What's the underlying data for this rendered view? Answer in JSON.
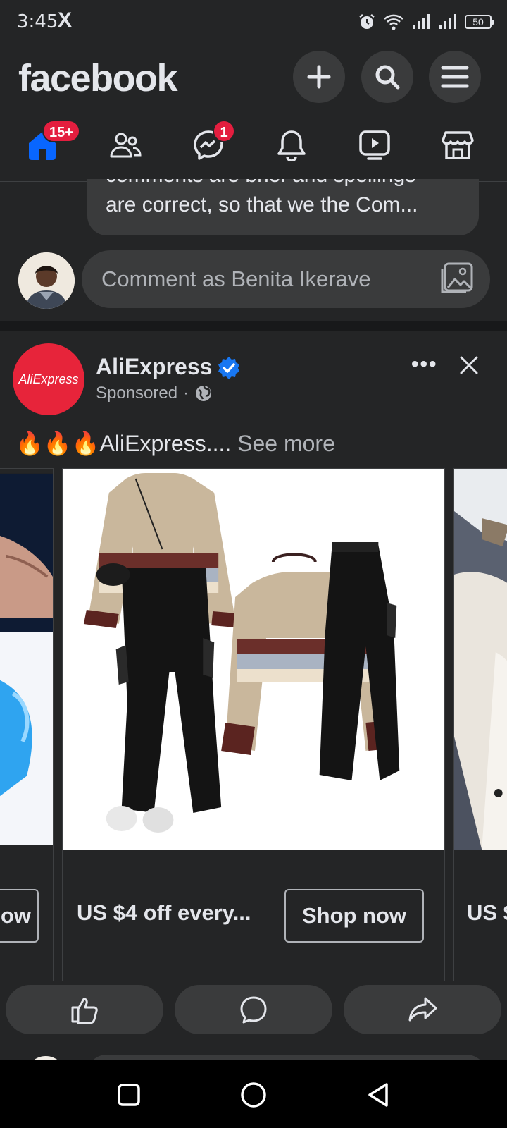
{
  "status_bar": {
    "time": "3:45",
    "x_glyph": "X",
    "battery": "50",
    "icons": [
      "alarm-icon",
      "wifi-icon",
      "signal-icon",
      "signal-icon",
      "battery-icon"
    ]
  },
  "header": {
    "logo": "facebook",
    "buttons": [
      "create-icon",
      "search-icon",
      "menu-icon"
    ]
  },
  "nav": {
    "home_badge": "15+",
    "messenger_badge": "1",
    "items": [
      "home-icon",
      "friends-icon",
      "messenger-icon",
      "notifications-icon",
      "video-icon",
      "marketplace-icon"
    ],
    "accent_color": "#0866ff"
  },
  "comment_preview": {
    "cut_line": "comments are brief and spellings",
    "line": "are correct, so that we the Com..."
  },
  "comment_input": {
    "placeholder": "Comment as Benita Ikerave"
  },
  "post": {
    "page_name": "AliExpress",
    "avatar_text": "AliExpress",
    "sponsored": "Sponsored",
    "dot": "·",
    "more": "•••",
    "text_prefix": "🔥🔥🔥",
    "text": "AliExpress....",
    "see_more": "See more",
    "brand_color": "#e7243a",
    "verified_color": "#1877f2"
  },
  "carousel": {
    "left_card": {
      "button_fragment": "ow"
    },
    "main_card": {
      "title": "US $4 off every...",
      "button": "Shop now"
    },
    "right_card": {
      "title_fragment": "US $"
    }
  },
  "actions": [
    "like-icon",
    "comment-icon",
    "share-icon"
  ],
  "android_nav": [
    "recents-button",
    "home-button",
    "back-button"
  ]
}
